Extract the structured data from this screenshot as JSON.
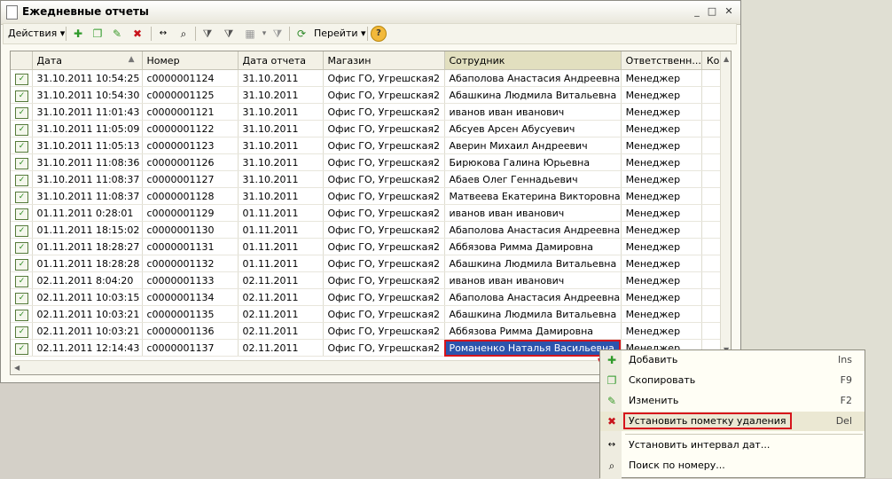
{
  "window": {
    "title": "Ежедневные отчеты"
  },
  "toolbar": {
    "actions_label": "Действия",
    "goto_label": "Перейти",
    "help_label": "?"
  },
  "table": {
    "columns": [
      "Дата",
      "Номер",
      "Дата отчета",
      "Магазин",
      "Сотрудник",
      "Ответственн...",
      "Ком"
    ],
    "rows": [
      [
        "31.10.2011 10:54:25",
        "с0000001124",
        "31.10.2011",
        "Офис ГО, Угрешская2",
        "Абаполова Анастасия Андреевна",
        "Менеджер"
      ],
      [
        "31.10.2011 10:54:30",
        "с0000001125",
        "31.10.2011",
        "Офис ГО, Угрешская2",
        "Абашкина Людмила Витальевна",
        "Менеджер"
      ],
      [
        "31.10.2011 11:01:43",
        "с0000001121",
        "31.10.2011",
        "Офис ГО, Угрешская2",
        "иванов иван иванович",
        "Менеджер"
      ],
      [
        "31.10.2011 11:05:09",
        "с0000001122",
        "31.10.2011",
        "Офис ГО, Угрешская2",
        "Абсуев Арсен Абусуевич",
        "Менеджер"
      ],
      [
        "31.10.2011 11:05:13",
        "с0000001123",
        "31.10.2011",
        "Офис ГО, Угрешская2",
        "Аверин Михаил Андреевич",
        "Менеджер"
      ],
      [
        "31.10.2011 11:08:36",
        "с0000001126",
        "31.10.2011",
        "Офис ГО, Угрешская2",
        "Бирюкова Галина Юрьевна",
        "Менеджер"
      ],
      [
        "31.10.2011 11:08:37",
        "с0000001127",
        "31.10.2011",
        "Офис ГО, Угрешская2",
        "Абаев Олег Геннадьевич",
        "Менеджер"
      ],
      [
        "31.10.2011 11:08:37",
        "с0000001128",
        "31.10.2011",
        "Офис ГО, Угрешская2",
        "Матвеева Екатерина Викторовна",
        "Менеджер"
      ],
      [
        "01.11.2011 0:28:01",
        "с0000001129",
        "01.11.2011",
        "Офис ГО, Угрешская2",
        "иванов иван иванович",
        "Менеджер"
      ],
      [
        "01.11.2011 18:15:02",
        "с0000001130",
        "01.11.2011",
        "Офис ГО, Угрешская2",
        "Абаполова Анастасия Андреевна",
        "Менеджер"
      ],
      [
        "01.11.2011 18:28:27",
        "с0000001131",
        "01.11.2011",
        "Офис ГО, Угрешская2",
        "Аббязова Римма Дамировна",
        "Менеджер"
      ],
      [
        "01.11.2011 18:28:28",
        "с0000001132",
        "01.11.2011",
        "Офис ГО, Угрешская2",
        "Абашкина Людмила Витальевна",
        "Менеджер"
      ],
      [
        "02.11.2011 8:04:20",
        "с0000001133",
        "02.11.2011",
        "Офис ГО, Угрешская2",
        "иванов иван иванович",
        "Менеджер"
      ],
      [
        "02.11.2011 10:03:15",
        "с0000001134",
        "02.11.2011",
        "Офис ГО, Угрешская2",
        "Абаполова Анастасия Андреевна",
        "Менеджер"
      ],
      [
        "02.11.2011 10:03:21",
        "с0000001135",
        "02.11.2011",
        "Офис ГО, Угрешская2",
        "Абашкина Людмила Витальевна",
        "Менеджер"
      ],
      [
        "02.11.2011 10:03:21",
        "с0000001136",
        "02.11.2011",
        "Офис ГО, Угрешская2",
        "Аббязова Римма Дамировна",
        "Менеджер"
      ],
      [
        "02.11.2011 12:14:43",
        "с0000001137",
        "02.11.2011",
        "Офис ГО, Угрешская2",
        "Романенко Наталья Васильевна",
        "Менеджер"
      ]
    ]
  },
  "context_menu": {
    "items": [
      {
        "label": "Добавить",
        "shortcut": "Ins",
        "icon": "add-icon"
      },
      {
        "label": "Скопировать",
        "shortcut": "F9",
        "icon": "copy-icon"
      },
      {
        "label": "Изменить",
        "shortcut": "F2",
        "icon": "edit-icon"
      },
      {
        "label": "Установить пометку удаления",
        "shortcut": "Del",
        "icon": "delete-mark-icon"
      },
      {
        "label": "Установить интервал дат...",
        "shortcut": "",
        "icon": "date-interval-icon"
      },
      {
        "label": "Поиск по номеру...",
        "shortcut": "",
        "icon": "search-number-icon"
      }
    ]
  },
  "colors": {
    "accent_red": "#d6141c",
    "selection": "#2c54ac"
  }
}
